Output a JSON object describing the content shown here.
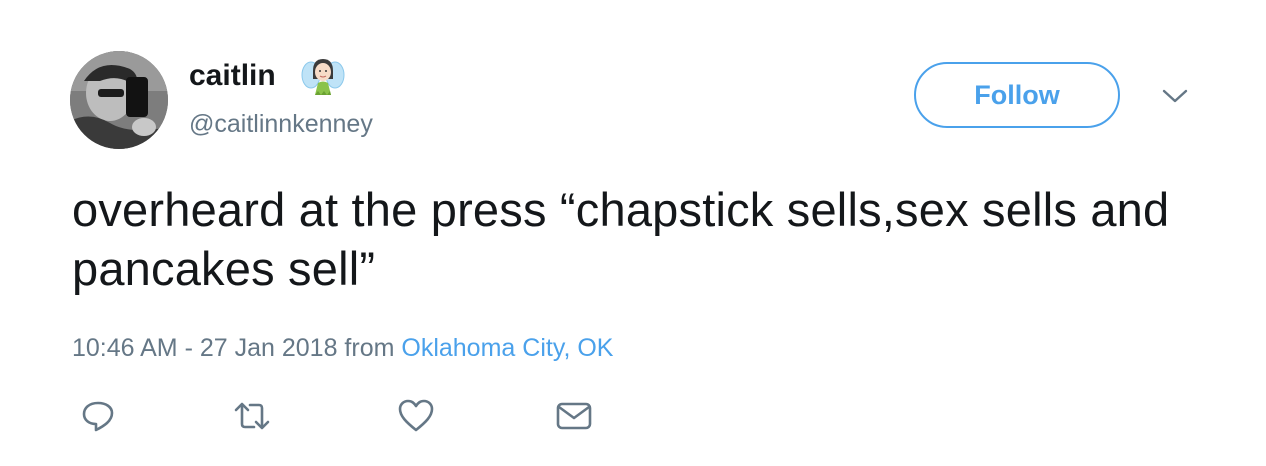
{
  "user": {
    "display_name": "caitlin",
    "handle": "@caitlinnkenney",
    "emoji": "fairy-emoji"
  },
  "follow_button": {
    "label": "Follow"
  },
  "tweet": {
    "text": "overheard at the press “chapstick sells,sex sells and pancakes sell”"
  },
  "meta": {
    "timestamp": "10:46 AM - 27 Jan 2018",
    "from_label": "from",
    "location": "Oklahoma City, OK"
  },
  "actions": [
    {
      "icon": "reply-icon"
    },
    {
      "icon": "retweet-icon"
    },
    {
      "icon": "like-icon"
    },
    {
      "icon": "direct-message-icon"
    }
  ],
  "colors": {
    "accent": "#4aa1eb",
    "text": "#14171a",
    "secondary": "#657786"
  }
}
